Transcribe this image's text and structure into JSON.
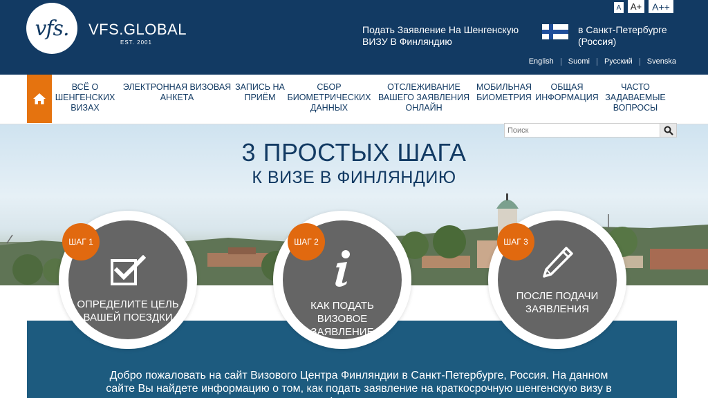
{
  "header": {
    "logo_mark": "vfs.",
    "logo_text": "VFS.GLOBAL",
    "logo_est": "EST. 2001",
    "font_sizes": [
      "A",
      "A+",
      "A++"
    ],
    "apply_text": "Подать Заявление На Шенгенскую ВИЗУ В Финляндию",
    "city_text": "в Санкт-Петербурге (Россия)",
    "languages": [
      "English",
      "Suomi",
      "Русский",
      "Svenska"
    ]
  },
  "nav": {
    "items": [
      {
        "label": "Всё о шенгенских визах"
      },
      {
        "label": "Электронная визовая анкета"
      },
      {
        "label": "Запись на приём"
      },
      {
        "label": "Сбор биометрических данных"
      },
      {
        "label": "Отслеживание вашего заявления онлайн"
      },
      {
        "label": "Мобильная биометрия"
      },
      {
        "label": "Общая информация"
      },
      {
        "label": "Часто задаваемые вопросы"
      }
    ]
  },
  "search": {
    "placeholder": "Поиск"
  },
  "hero": {
    "title": "3 ПРОСТЫХ ШАГА",
    "subtitle": "К ВИЗЕ В ФИНЛЯНДИЮ"
  },
  "steps": [
    {
      "badge": "ШАГ 1",
      "label": "Определите цель вашей поездки",
      "icon": "checkbox-icon"
    },
    {
      "badge": "ШАГ 2",
      "label": "Как подать визовое заявление",
      "icon": "info-icon"
    },
    {
      "badge": "ШАГ 3",
      "label": "После подачи заявления",
      "icon": "pencil-icon"
    }
  ],
  "welcome_text": "Добро пожаловать на сайт Визового Центра Финляндии в Санкт-Петербурге, Россия. На данном сайте Вы найдете информацию о том, как подать заявление на краткосрочную шенгенскую визу в Финляндию.",
  "colors": {
    "header_bg": "#123a63",
    "accent": "#e1690f",
    "panel": "#1d5b7f",
    "step_circle": "#656565"
  }
}
